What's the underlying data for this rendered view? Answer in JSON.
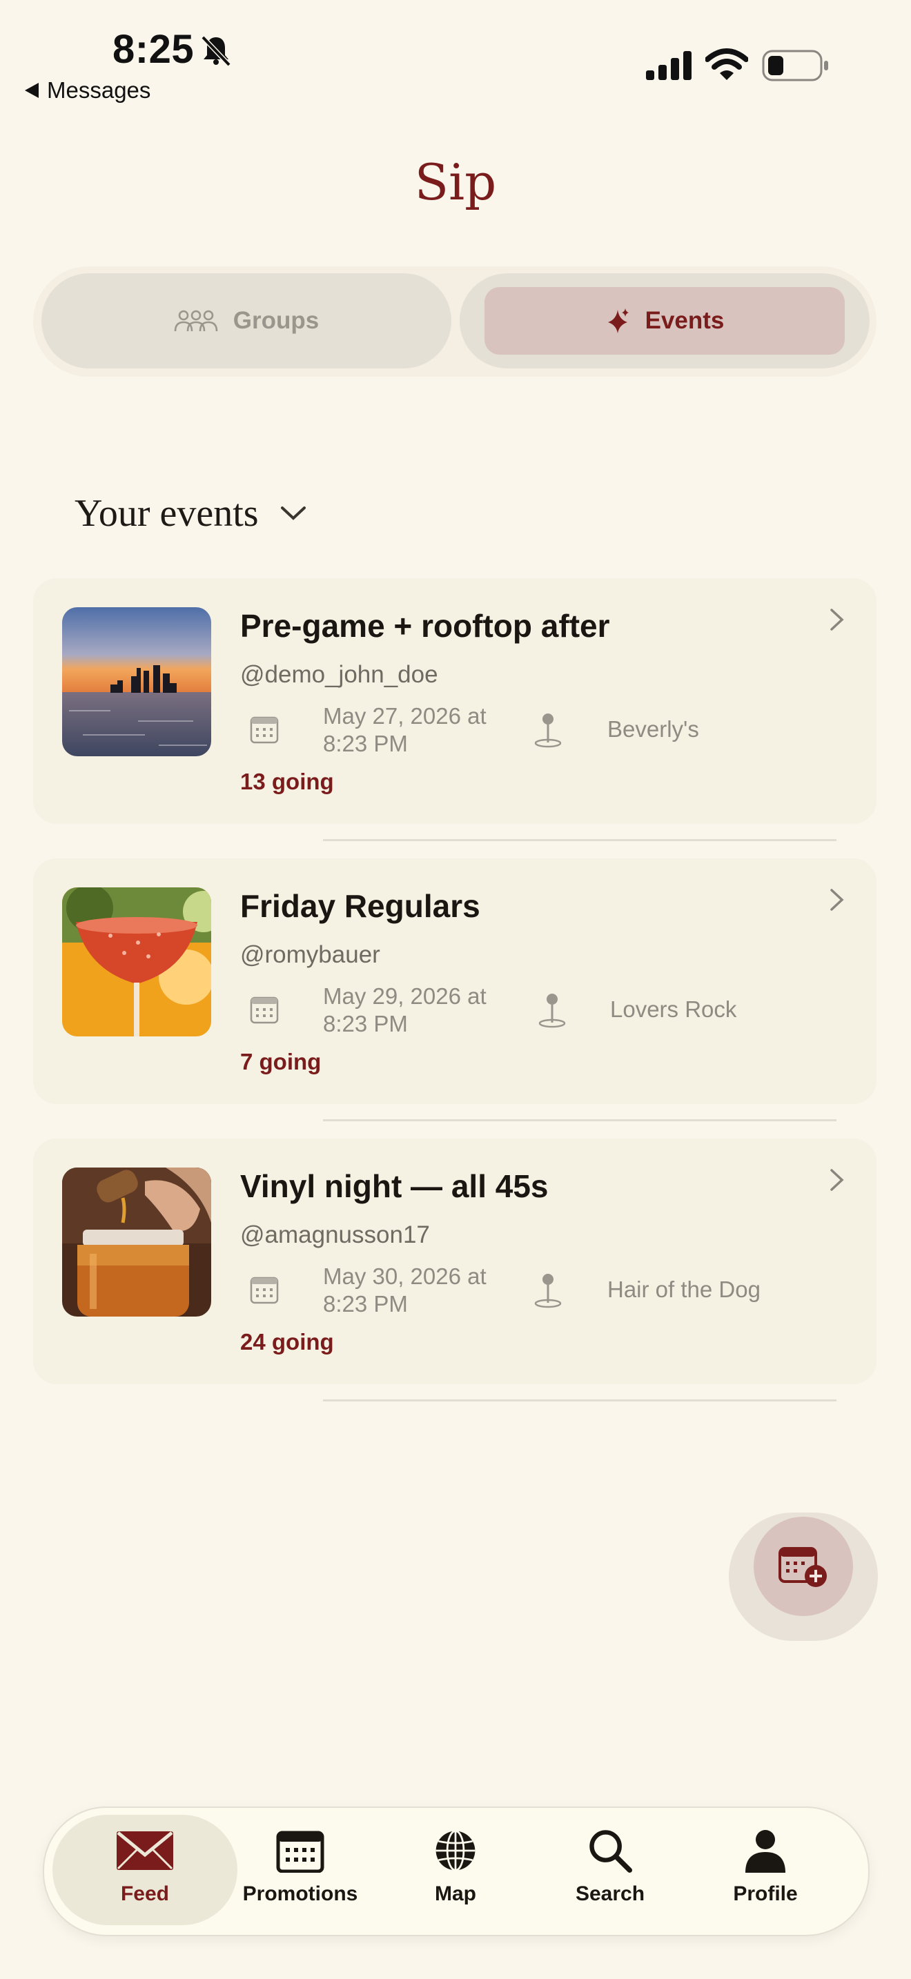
{
  "status_bar": {
    "time": "8:25",
    "back_label": "Messages"
  },
  "app": {
    "title": "Sip"
  },
  "segments": {
    "groups_label": "Groups",
    "events_label": "Events",
    "selected": "Events"
  },
  "section": {
    "title": "Your events"
  },
  "events": [
    {
      "title": "Pre-game + rooftop after",
      "host": "@demo_john_doe",
      "date_line1": "May 27, 2026 at",
      "date_line2": "8:23 PM",
      "place": "Beverly's",
      "going": "13 going"
    },
    {
      "title": "Friday Regulars",
      "host": "@romybauer",
      "date_line1": "May 29, 2026 at",
      "date_line2": "8:23 PM",
      "place": "Lovers Rock",
      "going": "7 going"
    },
    {
      "title": "Vinyl night — all 45s",
      "host": "@amagnusson17",
      "date_line1": "May 30, 2026 at",
      "date_line2": "8:23 PM",
      "place": "Hair of the Dog",
      "going": "24 going"
    }
  ],
  "tabbar": {
    "feed": "Feed",
    "promotions": "Promotions",
    "map": "Map",
    "search": "Search",
    "profile": "Profile",
    "active": "Feed"
  },
  "colors": {
    "background": "#faf6ec",
    "accent": "#7a1c1c",
    "selected_segment": "#d8c3be"
  }
}
